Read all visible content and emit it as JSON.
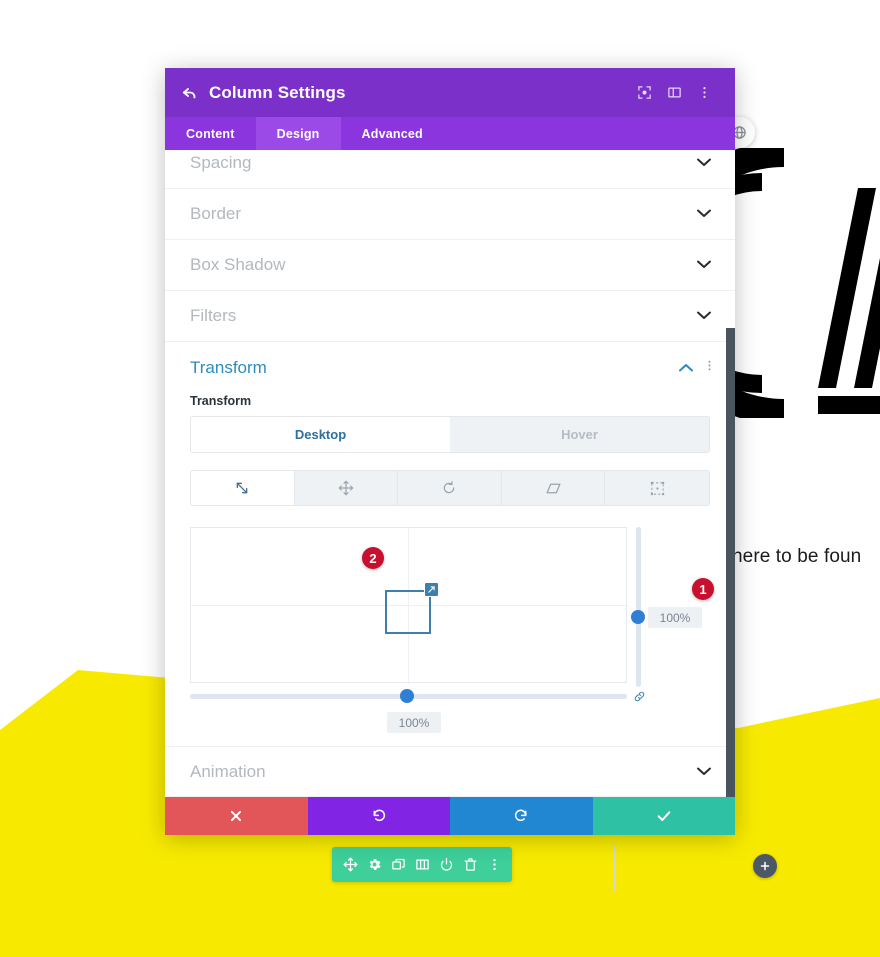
{
  "modal": {
    "title": "Column Settings",
    "back_icon": "back-arrow-icon",
    "header_icons": [
      {
        "name": "focus-target-icon",
        "label": ""
      },
      {
        "name": "layout-split-icon",
        "label": ""
      },
      {
        "name": "more-vertical-icon",
        "label": ""
      }
    ],
    "tabs": [
      {
        "label": "Content",
        "active": false
      },
      {
        "label": "Design",
        "active": true
      },
      {
        "label": "Advanced",
        "active": false
      }
    ],
    "sections": [
      {
        "label": "Spacing",
        "open": false
      },
      {
        "label": "Border",
        "open": false
      },
      {
        "label": "Box Shadow",
        "open": false
      },
      {
        "label": "Filters",
        "open": false
      }
    ],
    "transform_section": {
      "title": "Transform",
      "field_label": "Transform",
      "state_tabs": [
        {
          "label": "Desktop",
          "active": true
        },
        {
          "label": "Hover",
          "active": false
        }
      ],
      "mode_icons": [
        {
          "name": "scale-icon",
          "active": true
        },
        {
          "name": "translate-move-icon",
          "active": false
        },
        {
          "name": "rotate-icon",
          "active": false
        },
        {
          "name": "skew-icon",
          "active": false
        },
        {
          "name": "transform-origin-icon",
          "active": false
        }
      ],
      "vertical_value": "100%",
      "horizontal_value": "100%",
      "link_icon": "link-chain-icon",
      "badges": [
        {
          "text": "1"
        },
        {
          "text": "2"
        }
      ]
    },
    "animation_section": {
      "label": "Animation",
      "open": false
    },
    "actions": [
      {
        "name": "cancel-button",
        "icon": "close-x-icon",
        "color": "#e2565a"
      },
      {
        "name": "undo-button",
        "icon": "undo-icon",
        "color": "#8224e3"
      },
      {
        "name": "redo-button",
        "icon": "redo-icon",
        "color": "#2287d3"
      },
      {
        "name": "save-button",
        "icon": "check-icon",
        "color": "#2fc1a3"
      }
    ]
  },
  "module_toolbar": {
    "buttons": [
      {
        "name": "move-handle-icon"
      },
      {
        "name": "gear-settings-icon"
      },
      {
        "name": "duplicate-icon"
      },
      {
        "name": "columns-icon"
      },
      {
        "name": "disable-power-icon"
      },
      {
        "name": "trash-delete-icon"
      },
      {
        "name": "more-vertical-icon"
      }
    ]
  },
  "page": {
    "body_text": "here to be foun",
    "globe_button": "globe-icon",
    "add_button": "plus-icon",
    "colors": {
      "yellow": "#f7ea00",
      "purple_header": "#7b30c9",
      "purple_tabs": "#8a35dd",
      "accent_blue": "#2f7fd4",
      "badge_red": "#c8102e"
    }
  }
}
